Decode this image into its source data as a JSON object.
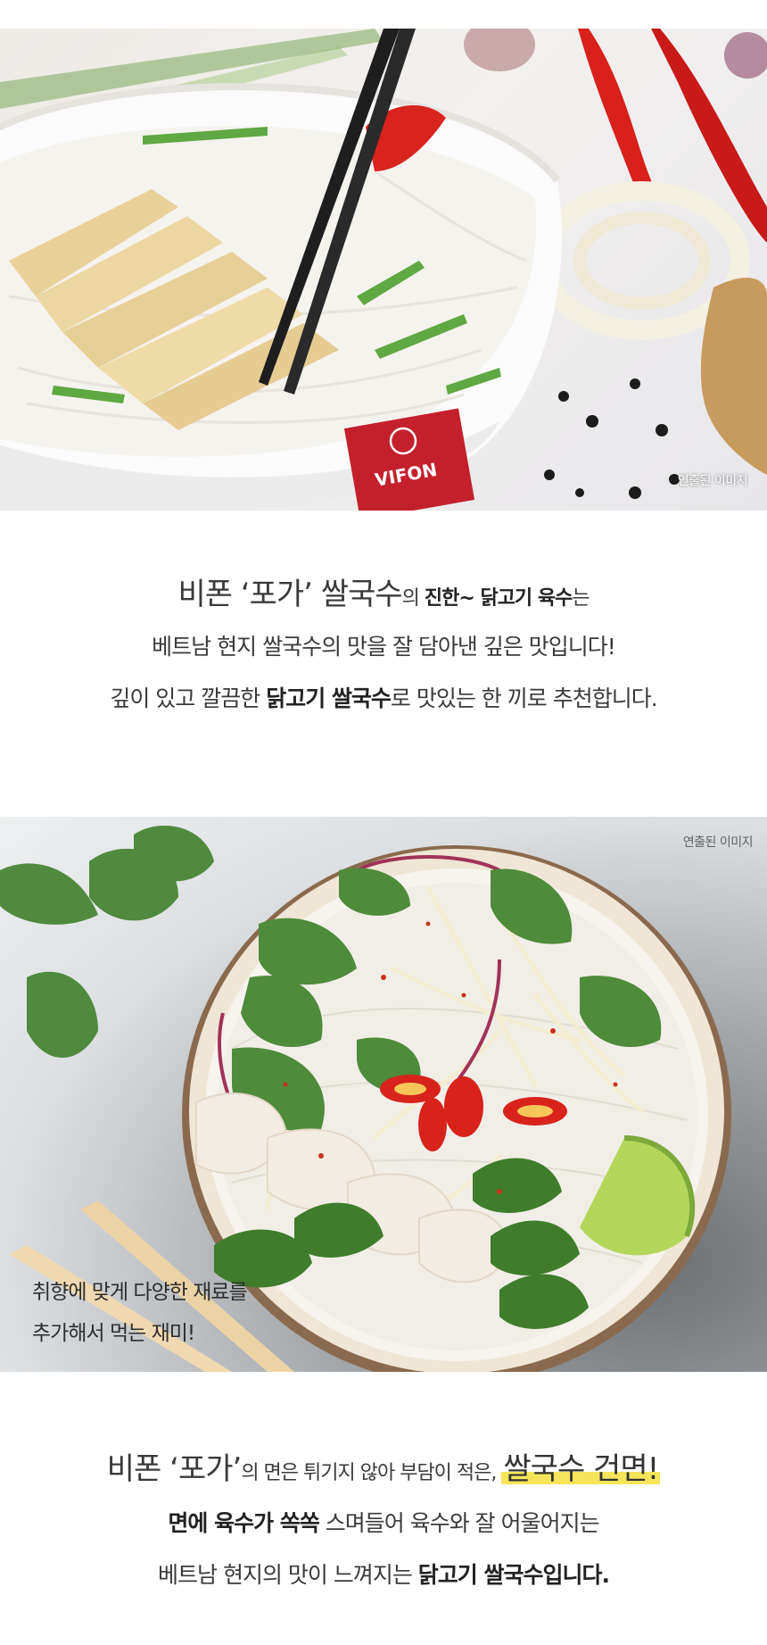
{
  "photo1": {
    "caption": "연출된 이미지",
    "bowl_brand": "VIFON"
  },
  "block1": {
    "line1": {
      "part1": "비폰 ‘포가’ 쌀국수",
      "part2": "의 ",
      "part3": "진한~ 닭고기 육수",
      "part4": "는"
    },
    "line2": "베트남 현지 쌀국수의 맛을 잘 담아낸 깊은 맛입니다!",
    "line3": {
      "part1": "깊이 있고 깔끔한 ",
      "part2": "닭고기 쌀국수",
      "part3": "로 맛있는 한 끼로 추천합니다."
    }
  },
  "photo2": {
    "caption": "연출된 이미지",
    "overlay_line1": "취향에 맞게 다양한 재료를",
    "overlay_line2": "추가해서 먹는 재미!"
  },
  "block2": {
    "line1": {
      "part1": "비폰 ‘포가’",
      "part2": "의 면은 튀기지 않아 부담이 적은, ",
      "part3": "쌀국수 건면!"
    },
    "line2": {
      "part1": "면에 육수가 쏙쏙",
      "part2": " 스며들어 육수와 잘 어울어지는"
    },
    "line3": {
      "part1": "베트남 현지의 맛이 느껴지는 ",
      "part2": "닭고기 쌀국수입니다."
    }
  },
  "colors": {
    "highlight": "#f6e55a",
    "bowl_red": "#c4202b",
    "text": "#3a3a3a"
  }
}
